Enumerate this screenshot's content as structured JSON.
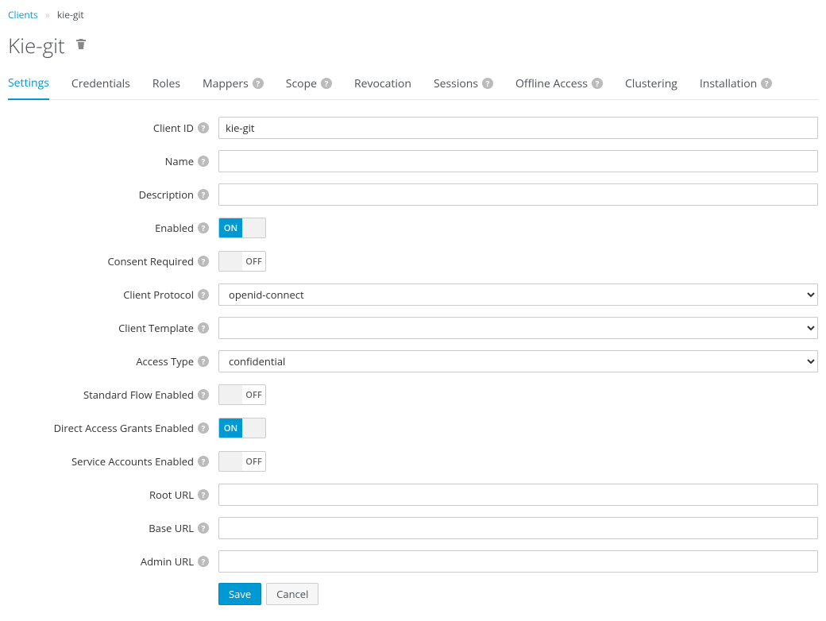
{
  "breadcrumb": {
    "parent": "Clients",
    "current": "kie-git"
  },
  "page_title": "Kie-git",
  "tabs": [
    {
      "label": "Settings",
      "help": false,
      "active": true
    },
    {
      "label": "Credentials",
      "help": false,
      "active": false
    },
    {
      "label": "Roles",
      "help": false,
      "active": false
    },
    {
      "label": "Mappers",
      "help": true,
      "active": false
    },
    {
      "label": "Scope",
      "help": true,
      "active": false
    },
    {
      "label": "Revocation",
      "help": false,
      "active": false
    },
    {
      "label": "Sessions",
      "help": true,
      "active": false
    },
    {
      "label": "Offline Access",
      "help": true,
      "active": false
    },
    {
      "label": "Clustering",
      "help": false,
      "active": false
    },
    {
      "label": "Installation",
      "help": true,
      "active": false
    }
  ],
  "fields": {
    "client_id": {
      "label": "Client ID",
      "value": "kie-git"
    },
    "name": {
      "label": "Name",
      "value": ""
    },
    "description": {
      "label": "Description",
      "value": ""
    },
    "enabled": {
      "label": "Enabled",
      "on": true,
      "on_text": "ON",
      "off_text": "OFF"
    },
    "consent_required": {
      "label": "Consent Required",
      "on": false,
      "on_text": "ON",
      "off_text": "OFF"
    },
    "client_protocol": {
      "label": "Client Protocol",
      "value": "openid-connect"
    },
    "client_template": {
      "label": "Client Template",
      "value": ""
    },
    "access_type": {
      "label": "Access Type",
      "value": "confidential"
    },
    "standard_flow_enabled": {
      "label": "Standard Flow Enabled",
      "on": false,
      "on_text": "ON",
      "off_text": "OFF"
    },
    "direct_access_grants_enabled": {
      "label": "Direct Access Grants Enabled",
      "on": true,
      "on_text": "ON",
      "off_text": "OFF"
    },
    "service_accounts_enabled": {
      "label": "Service Accounts Enabled",
      "on": false,
      "on_text": "ON",
      "off_text": "OFF"
    },
    "root_url": {
      "label": "Root URL",
      "value": ""
    },
    "base_url": {
      "label": "Base URL",
      "value": ""
    },
    "admin_url": {
      "label": "Admin URL",
      "value": ""
    }
  },
  "buttons": {
    "save": "Save",
    "cancel": "Cancel"
  }
}
